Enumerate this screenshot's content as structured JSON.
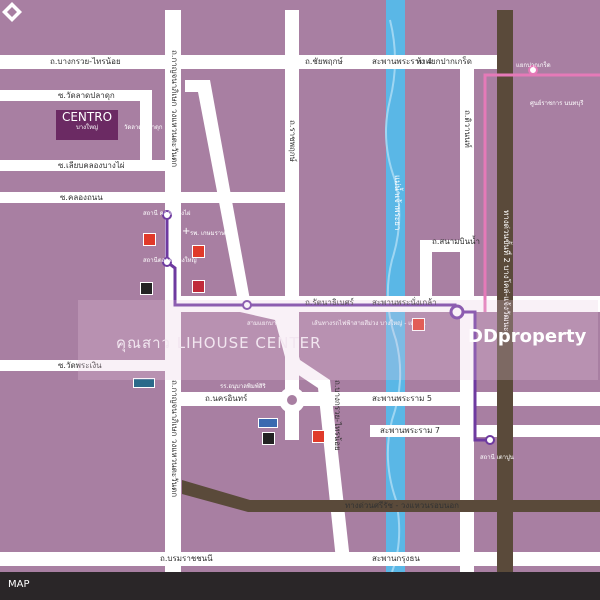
{
  "roads": {
    "bang_kruai_sai_noi": "ถ.บางกรวย-ไทรน้อย",
    "chaiyaphruek": "ถ.ชัยพฤกษ์",
    "wat_lat_pla_duk": "ซ.วัดลาดปลาดุก",
    "liap_khlong_bang_phai": "ซ.เลียบคลองบางไผ่",
    "khlong_thanon": "ซ.คลองถนน",
    "kanchanaphisek_upper": "ถ.กาญจนาภิเษก วงแหวนตะวันตก",
    "ratchaphruek": "ถ.ราชพฤกษ์",
    "sanambinnam": "ถ.สนามบินน้ำ",
    "rattanathibet": "ถ.รัตนาธิเบศร์",
    "wat_phra_ngoen": "ซ.วัดพระเงิน",
    "nakhon_in": "ถ.นครอินทร์",
    "kanchanaphisek_lower": "ถ.กาญจนาภิเษก วงแหวนตะวันตก",
    "bang_kruai_sai_noi_v": "ถ.บางกรวย-ไทรน้อย",
    "expressway": "ทางด่วนศรีรัช - วงแหวนรอบนอก",
    "borommaratchachonnani": "ถ.บรมราชชนนี",
    "tiwanon": "ถ.ติวานนท์",
    "expressway_v": "ทางด่วนขั้นที่ 2 บางโคล่-แจ้งวัฒนะ"
  },
  "bridges": {
    "phra_nang_klao": "สะพานพระนั่งเกล้า",
    "rama4": "สะพานพระราม 4",
    "rama5": "สะพานพระราม 5",
    "rama7": "สะพานพระราม 7",
    "krung_thon": "สะพานกรุงธน"
  },
  "river": "แม่น้ำเจ้าพระยา",
  "junctions": {
    "pak_kret": "ห้าแยกปากเกร็ด",
    "nonthaburi_centre": "ศูนย์ราชการ นนทบุรี"
  },
  "stations": {
    "khlong_bang_phai": "สถานี คลองบางไผ่",
    "talad_bang_yai": "สถานีตลาด บางใหญ่",
    "sam_yaek_bang_yai": "สามแยกบางใหญ่",
    "tao_pun": "สถานี เตาปูน",
    "pak_kret": "แยกปากเกร็ด"
  },
  "places": {
    "centro": "CENTRO",
    "centro_sub": "บางใหญ่",
    "wat_ladpla": "วัดลาด ปลาดุก",
    "hospital": "รพ. เกษมราษฎร์",
    "school": "รร.อนุบาลพิมพ์สิริ",
    "ministry": "เส้นทางรถไฟฟ้าสายสีม่วง บางใหญ่ - เตาปูน"
  },
  "watermark": "คุณสาว LIHOUSE CENTER",
  "brand": "DDproperty",
  "footer": "MAP"
}
